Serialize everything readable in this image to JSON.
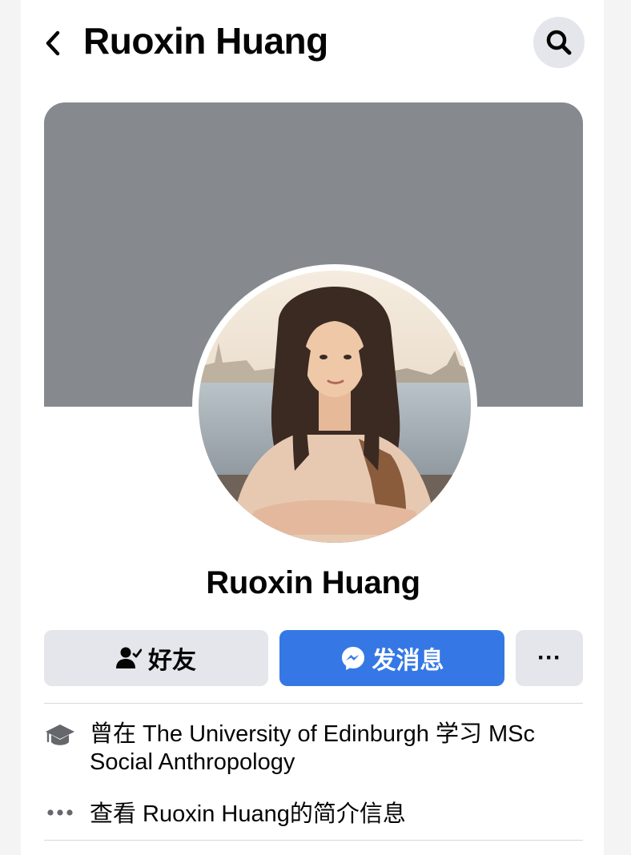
{
  "header": {
    "back_icon": "chevron-left-icon",
    "title": "Ruoxin Huang",
    "search_icon": "search-icon"
  },
  "profile": {
    "cover_color": "#868a8e",
    "name": "Ruoxin Huang"
  },
  "actions": {
    "friends_label": "好友",
    "friends_icon": "person-check-icon",
    "message_label": "发消息",
    "message_icon": "messenger-icon",
    "message_color": "#3578e5",
    "more_label": "···"
  },
  "details": {
    "education_icon": "graduation-cap-icon",
    "education_text": "曾在 The University of Edinburgh 学习 MSc Social Anthropology",
    "about_icon": "more-dots-icon",
    "about_text": "查看 Ruoxin Huang的简介信息"
  }
}
